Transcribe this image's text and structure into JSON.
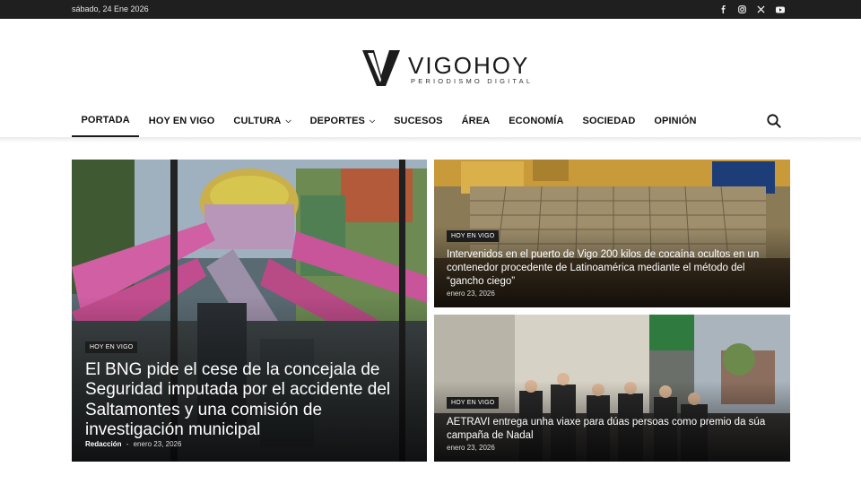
{
  "topbar": {
    "date": "sábado, 24 Ene 2026",
    "social": [
      "facebook-icon",
      "instagram-icon",
      "x-icon",
      "youtube-icon"
    ]
  },
  "logo": {
    "name": "VIGOHOY",
    "tagline": "PERIODISMO DIGITAL"
  },
  "nav": {
    "items": [
      {
        "label": "PORTADA",
        "active": true
      },
      {
        "label": "HOY EN VIGO"
      },
      {
        "label": "CULTURA",
        "dropdown": true
      },
      {
        "label": "DEPORTES",
        "dropdown": true
      },
      {
        "label": "SUCESOS"
      },
      {
        "label": "ÁREA"
      },
      {
        "label": "ECONOMÍA"
      },
      {
        "label": "SOCIEDAD"
      },
      {
        "label": "OPINIÓN"
      }
    ],
    "search_icon": "search-icon"
  },
  "featured": {
    "main": {
      "category": "HOY EN VIGO",
      "title": "El BNG pide el cese de la concejala de Seguridad imputada por el accidente del Saltamontes y una comisión de investigación municipal",
      "author": "Redacción",
      "separator": "-",
      "date": "enero 23, 2026"
    },
    "side": [
      {
        "category": "HOY EN VIGO",
        "title": "Intervenidos en el puerto de Vigo 200 kilos de cocaína ocultos en un contenedor procedente de Latinoamérica mediante el método del “gancho ciego”",
        "date": "enero 23, 2026"
      },
      {
        "category": "HOY EN VIGO",
        "title": "AETRAVI entrega unha viaxe para dúas persoas como premio da súa campaña de Nadal",
        "date": "enero 23, 2026"
      }
    ]
  },
  "colors": {
    "topbar": "#1f1f1f",
    "badge": "#1d1d1d",
    "text": "#111111"
  }
}
